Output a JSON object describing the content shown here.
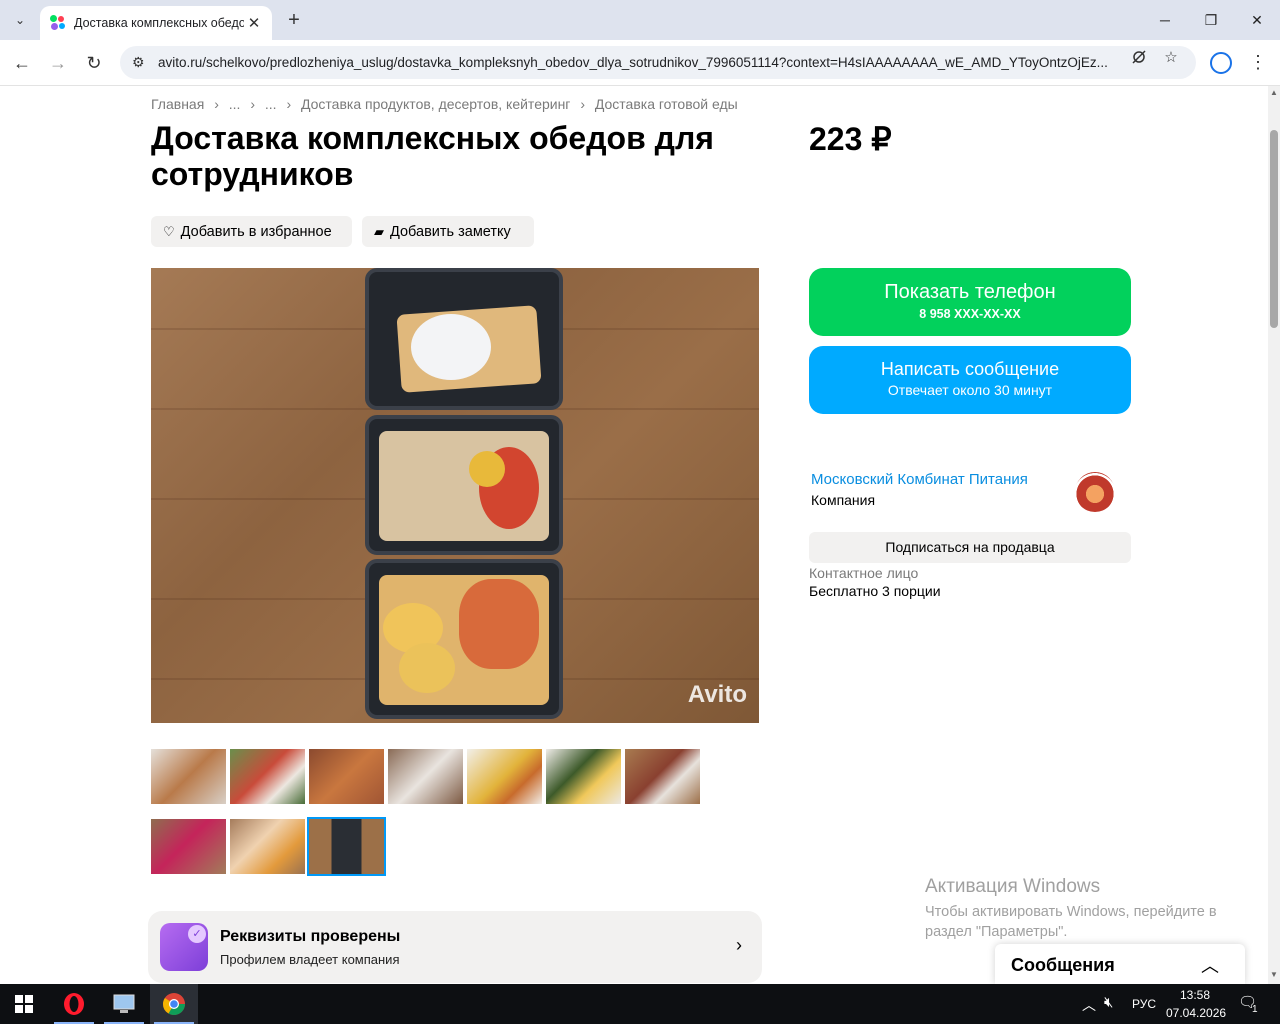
{
  "browser": {
    "tab_title": "Доставка комплексных обедов",
    "url": "avito.ru/schelkovo/predlozheniya_uslug/dostavka_kompleksnyh_obedov_dlya_sotrudnikov_7996051114?context=H4sIAAAAAAAA_wE_AMD_YToyOntzOjEz..."
  },
  "breadcrumbs": [
    "Главная",
    "›",
    "...",
    "›",
    "...",
    "›",
    "Доставка продуктов, десертов, кейтеринг",
    "›",
    "Доставка готовой еды"
  ],
  "listing": {
    "title": "Доставка комплексных обедов для сотрудников",
    "price": "223 ₽",
    "favorite_label": "Добавить в избранное",
    "note_label": "Добавить заметку",
    "watermark": "Avito",
    "thumbnail_count": 10,
    "active_thumbnail": 10
  },
  "verified": {
    "title": "Реквизиты проверены",
    "subtitle": "Профилем владеет компания",
    "arrow": "›"
  },
  "contact": {
    "phone_label": "Показать телефон",
    "phone_number": "8 958 XXX-XX-XX",
    "message_label": "Написать сообщение",
    "message_sub": "Отвечает около 30 минут",
    "seller_name": "Московский Комбинат Питания",
    "seller_type": "Компания",
    "subscribe_label": "Подписаться на продавца",
    "contact_person_label": "Контактное лицо",
    "contact_person_value": "Бесплатно 3 порции"
  },
  "windows_activation": {
    "title": "Активация Windows",
    "text": "Чтобы активировать Windows, перейдите в раздел \"Параметры\"."
  },
  "messages_panel": {
    "title": "Сообщения"
  },
  "taskbar": {
    "language": "РУС",
    "time": "13:58",
    "date": "07.04.2026",
    "notification_count": "1"
  },
  "colors": {
    "phone_button": "#02d15c",
    "message_button": "#00aaff",
    "seller_link": "#0a8ee0",
    "active_thumb_border": "#0099f7"
  }
}
